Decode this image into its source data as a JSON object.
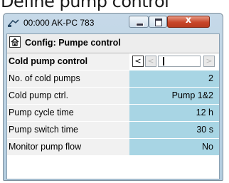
{
  "caption": "Define pump control",
  "window": {
    "title": "00:000 AK-PC 783",
    "close_glyph": "x"
  },
  "header": {
    "title": "Config: Pumpe control"
  },
  "rows": [
    {
      "label": "Cold pump control",
      "value": ""
    },
    {
      "label": "No. of cold pumps",
      "value": "2"
    },
    {
      "label": "Cold pump ctrl.",
      "value": "Pump 1&2"
    },
    {
      "label": "Pump cycle time",
      "value": "12 h"
    },
    {
      "label": "Pump switch time",
      "value": "30 s"
    },
    {
      "label": "Monitor pump flow",
      "value": "No"
    }
  ],
  "nav": {
    "prev_glyph": "<",
    "prev2_glyph": "<",
    "next_glyph": ">"
  },
  "colors": {
    "value_bg": "#a8d5e4",
    "label_bg": "#f1f1f1",
    "close_button": "#c8472a"
  }
}
